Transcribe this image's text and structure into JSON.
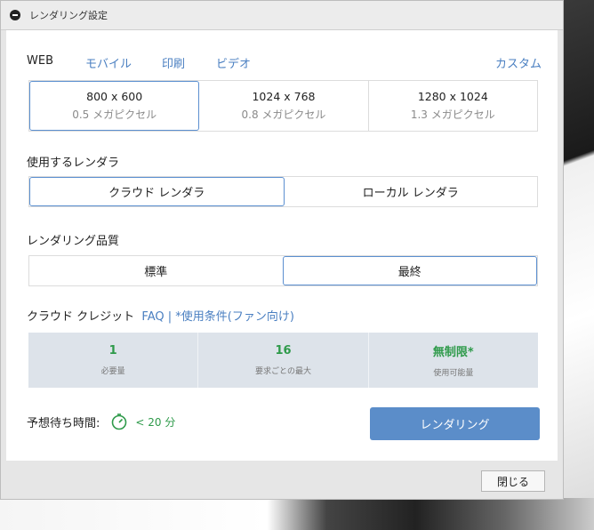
{
  "window": {
    "title": "レンダリング設定"
  },
  "tabs": [
    {
      "label": "WEB",
      "style": "plain"
    },
    {
      "label": "モバイル",
      "style": "link"
    },
    {
      "label": "印刷",
      "style": "link"
    },
    {
      "label": "ビデオ",
      "style": "link"
    },
    {
      "label": "カスタム",
      "style": "link"
    }
  ],
  "resolutions": [
    {
      "dim": "800 x 600",
      "mp": "0.5 メガピクセル",
      "selected": true
    },
    {
      "dim": "1024 x 768",
      "mp": "0.8 メガピクセル",
      "selected": false
    },
    {
      "dim": "1280 x 1024",
      "mp": "1.3 メガピクセル",
      "selected": false
    }
  ],
  "renderer": {
    "label": "使用するレンダラ",
    "options": [
      "クラウド レンダラ",
      "ローカル レンダラ"
    ],
    "selected_index": 0
  },
  "quality": {
    "label": "レンダリング品質",
    "options": [
      "標準",
      "最終"
    ],
    "selected_index": 1
  },
  "credits": {
    "title": "クラウド クレジット",
    "faq": "FAQ",
    "separator": "|",
    "terms": "*使用条件(ファン向け)",
    "cells": [
      {
        "value": "1",
        "caption": "必要量"
      },
      {
        "value": "16",
        "caption": "要求ごとの最大"
      },
      {
        "value": "無制限*",
        "caption": "使用可能量"
      }
    ]
  },
  "wait": {
    "label": "予想待ち時間:",
    "value": "< 20 分",
    "icon": "timer-icon"
  },
  "render_button": "レンダリング",
  "close_button": "閉じる",
  "colors": {
    "accent": "#5b8dc9",
    "link": "#4a7fc1",
    "green": "#2e9a4a",
    "credit_bg": "#dde3ea"
  }
}
